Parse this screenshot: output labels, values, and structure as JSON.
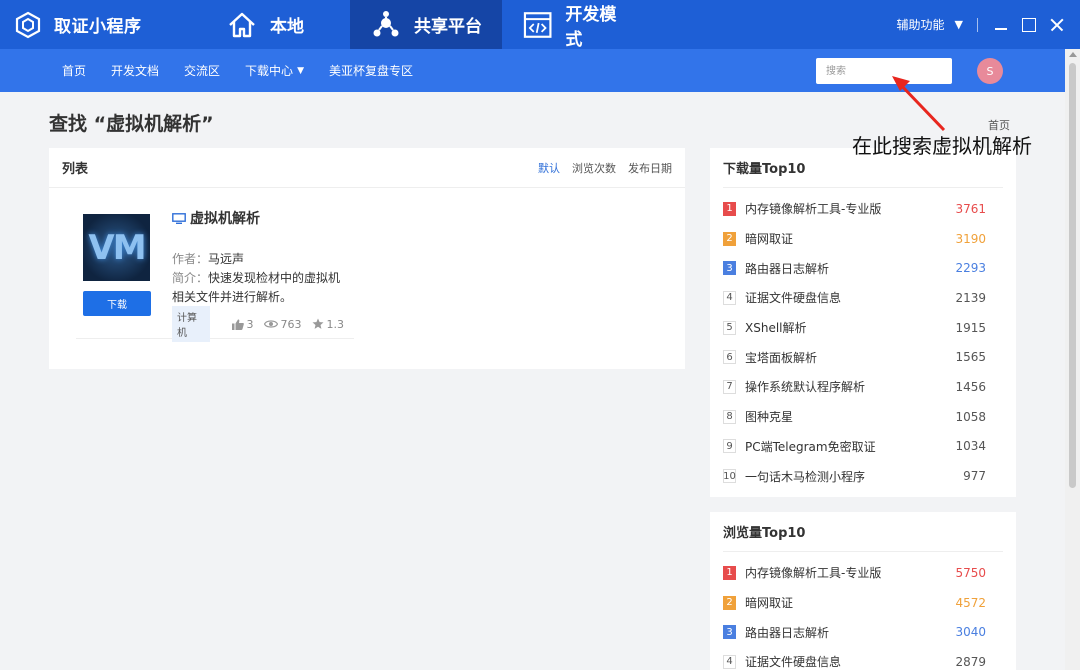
{
  "app": {
    "brand": "取证小程序",
    "tabs": [
      {
        "label": "本地"
      },
      {
        "label": "共享平台"
      },
      {
        "label": "开发模式"
      }
    ],
    "assist_label": "辅助功能"
  },
  "subnav": {
    "items": [
      "首页",
      "开发文档",
      "交流区",
      "下载中心",
      "美亚杯复盘专区"
    ],
    "search_placeholder": "搜索",
    "avatar_letter": "S"
  },
  "page": {
    "title": "查找 “虚拟机解析”",
    "breadcrumb": "首页"
  },
  "list": {
    "title": "列表",
    "sort_options": [
      "默认",
      "浏览次数",
      "发布日期"
    ],
    "item": {
      "thumb_text": "VM",
      "download_label": "下载",
      "name": "虚拟机解析",
      "author_label": "作者：",
      "author": "马远声",
      "desc_label": "简介：",
      "desc": "快速发现检材中的虚拟机相关文件并进行解析。",
      "tag": "计算机",
      "likes": "3",
      "views": "763",
      "rating": "1.3"
    }
  },
  "downloads_top": {
    "title": "下载量Top10",
    "rows": [
      {
        "rank": "1",
        "name": "内存镜像解析工具-专业版",
        "value": "3761"
      },
      {
        "rank": "2",
        "name": "暗网取证",
        "value": "3190"
      },
      {
        "rank": "3",
        "name": "路由器日志解析",
        "value": "2293"
      },
      {
        "rank": "4",
        "name": "证据文件硬盘信息",
        "value": "2139"
      },
      {
        "rank": "5",
        "name": "XShell解析",
        "value": "1915"
      },
      {
        "rank": "6",
        "name": "宝塔面板解析",
        "value": "1565"
      },
      {
        "rank": "7",
        "name": "操作系统默认程序解析",
        "value": "1456"
      },
      {
        "rank": "8",
        "name": "图种克星",
        "value": "1058"
      },
      {
        "rank": "9",
        "name": "PC端Telegram免密取证",
        "value": "1034"
      },
      {
        "rank": "10",
        "name": "一句话木马检测小程序",
        "value": "977"
      }
    ]
  },
  "views_top": {
    "title": "浏览量Top10",
    "rows": [
      {
        "rank": "1",
        "name": "内存镜像解析工具-专业版",
        "value": "5750"
      },
      {
        "rank": "2",
        "name": "暗网取证",
        "value": "4572"
      },
      {
        "rank": "3",
        "name": "路由器日志解析",
        "value": "3040"
      },
      {
        "rank": "4",
        "name": "证据文件硬盘信息",
        "value": "2879"
      }
    ]
  },
  "annotation": {
    "text": "在此搜索虚拟机解析"
  }
}
